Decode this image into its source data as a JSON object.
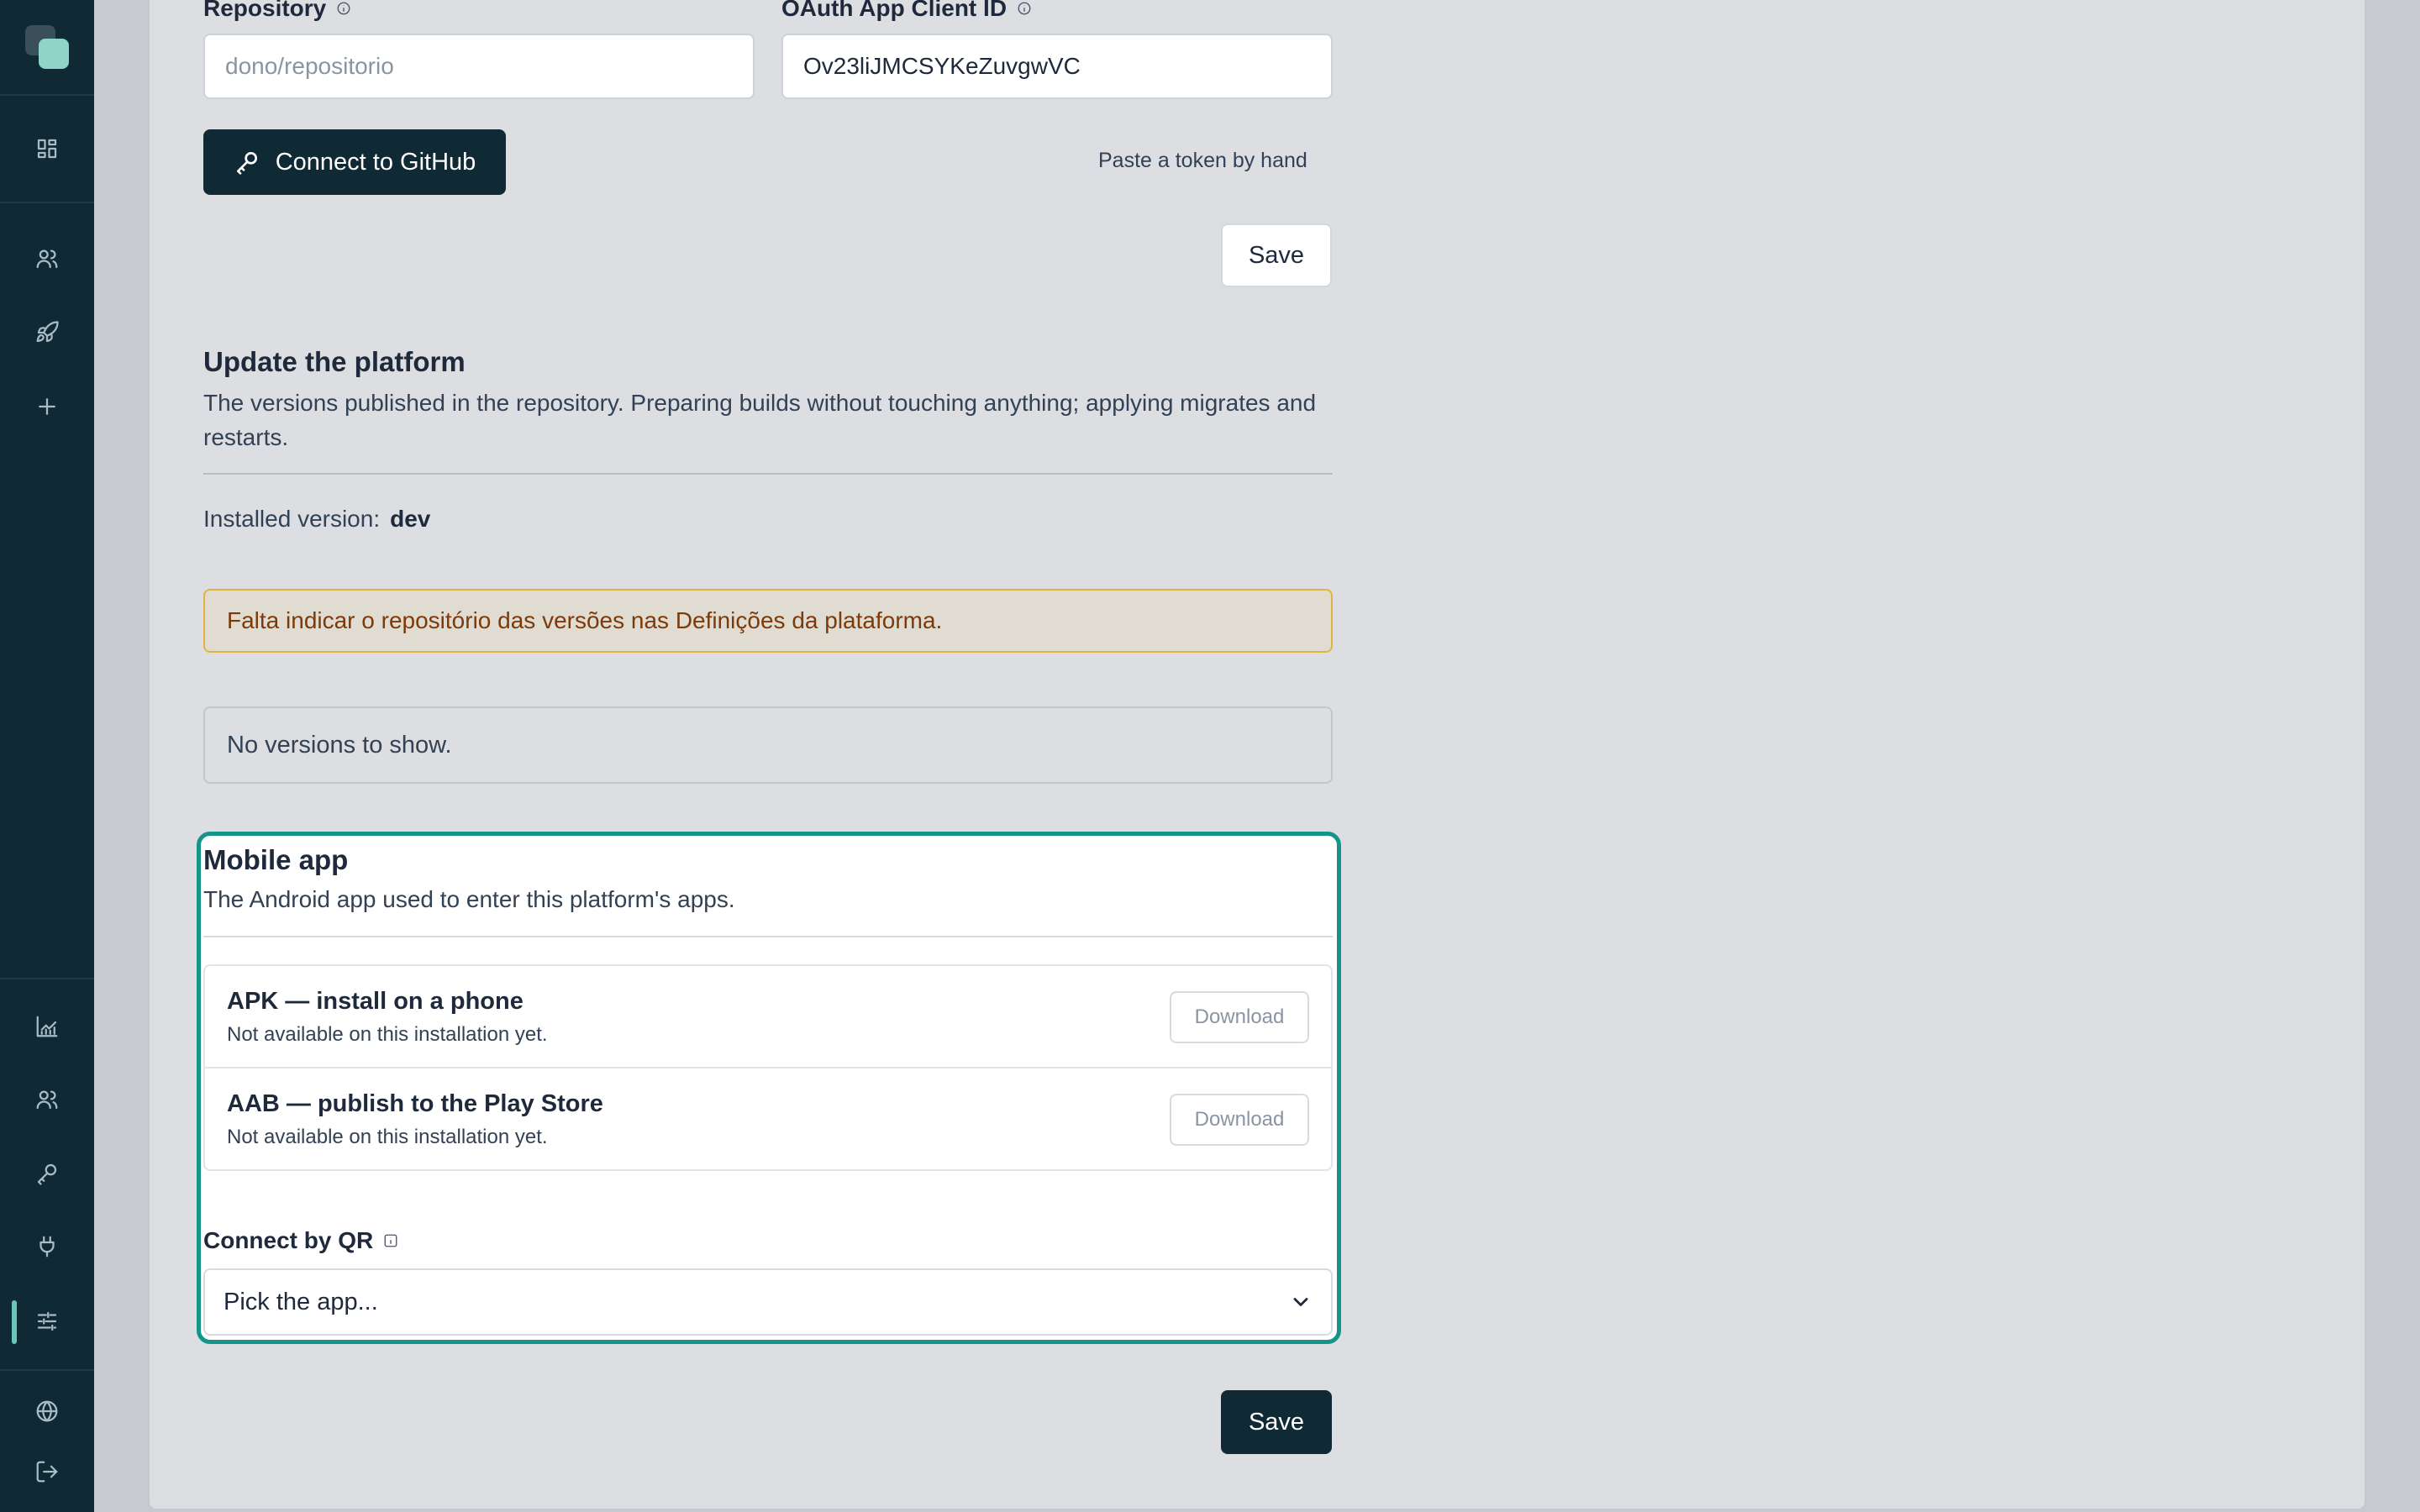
{
  "sidebar": {
    "icons": [
      "dashboard-icon",
      "users-icon",
      "rocket-icon",
      "plus-icon",
      "chart-icon",
      "team-icon",
      "key-icon",
      "plug-icon",
      "sliders-icon",
      "globe-icon",
      "logout-icon"
    ],
    "active": "sliders-icon"
  },
  "github": {
    "repository_label": "Repository",
    "repository_placeholder": "dono/repositorio",
    "client_id_label": "OAuth App Client ID",
    "client_id_value": "Ov23liJMCSYKeZuvgwVC",
    "connect_label": "Connect to GitHub",
    "paste_token_label": "Paste a token by hand",
    "save_label": "Save"
  },
  "update": {
    "title": "Update the platform",
    "description": "The versions published in the repository. Preparing builds without touching anything; applying migrates and restarts.",
    "installed_label": "Installed version:",
    "installed_value": "dev",
    "warning": "Falta indicar o repositório das versões nas Definições da plataforma.",
    "empty": "No versions to show."
  },
  "mobile": {
    "title": "Mobile app",
    "description": "The Android app used to enter this platform's apps.",
    "downloads": [
      {
        "title": "APK — install on a phone",
        "subtitle": "Not available on this installation yet.",
        "button": "Download"
      },
      {
        "title": "AAB — publish to the Play Store",
        "subtitle": "Not available on this installation yet.",
        "button": "Download"
      }
    ],
    "qr_label": "Connect by QR",
    "select_placeholder": "Pick the app..."
  },
  "footer": {
    "save_label": "Save"
  },
  "colors": {
    "sidebar": "#102a35",
    "accent": "#14958a",
    "warning_border": "#e3b341"
  }
}
